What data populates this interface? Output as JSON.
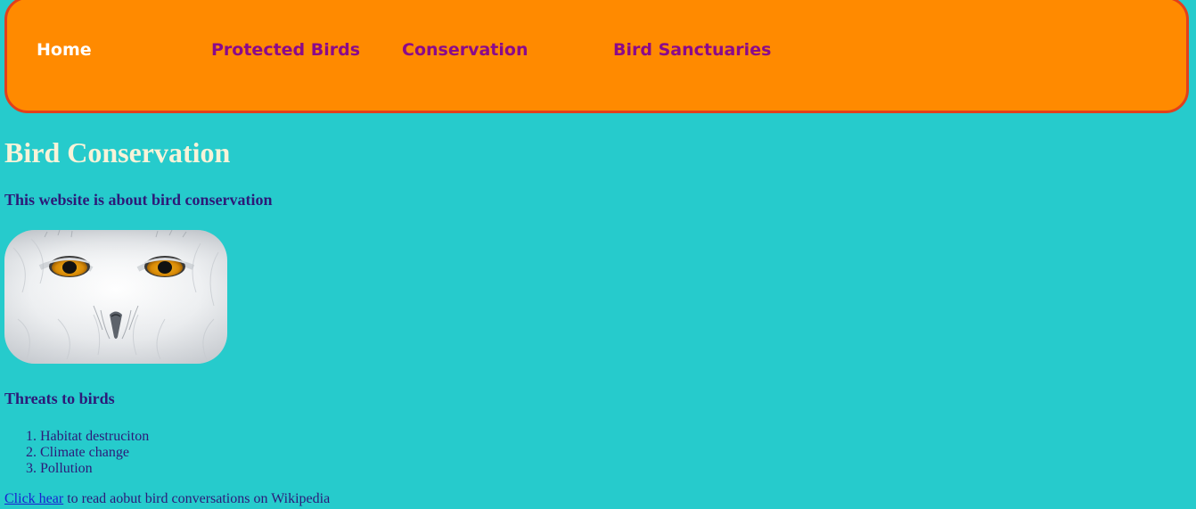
{
  "nav": {
    "items": [
      {
        "label": "Home",
        "active": true
      },
      {
        "label": "Protected Birds",
        "active": false
      },
      {
        "label": "Conservation",
        "active": false
      },
      {
        "label": "Bird Sanctuaries",
        "active": false
      }
    ]
  },
  "main": {
    "title": "Bird Conservation",
    "subtitle": "This website is about bird conservation",
    "image_subject": "snowy owl",
    "threats": {
      "heading": "Threats to birds",
      "items": [
        "Habitat destruciton",
        "Climate change",
        "Pollution"
      ]
    },
    "footer": {
      "link_text": "Click hear",
      "trailing_text": " to read aobut bird conversations on Wikipedia"
    }
  },
  "colors": {
    "page_background": "#26CBCC",
    "nav_background": "#FF8A00",
    "nav_border": "#E23F1C",
    "nav_link": "#8B0A8B",
    "nav_active": "#FFFFFF",
    "title": "#F8F3D8",
    "body_text": "#2D1A78",
    "link": "#1A1FD0"
  }
}
